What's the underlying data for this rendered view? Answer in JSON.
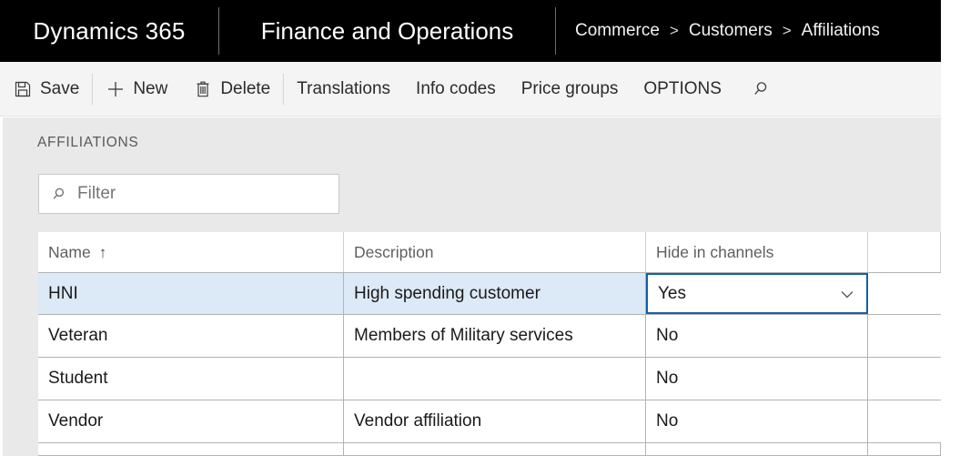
{
  "navbar": {
    "brand": "Dynamics 365",
    "app": "Finance and Operations",
    "breadcrumb": [
      "Commerce",
      "Customers",
      "Affiliations"
    ],
    "separator": ">"
  },
  "toolbar": {
    "items": [
      {
        "label": "Save",
        "icon": "save-icon"
      },
      {
        "label": "New",
        "icon": "plus-icon"
      },
      {
        "label": "Delete",
        "icon": "trash-icon"
      },
      {
        "label": "Translations",
        "icon": ""
      },
      {
        "label": "Info codes",
        "icon": ""
      },
      {
        "label": "Price groups",
        "icon": ""
      },
      {
        "label": "OPTIONS",
        "icon": ""
      }
    ],
    "search_icon": "search-icon"
  },
  "page": {
    "section_title": "AFFILIATIONS"
  },
  "filter": {
    "icon": "search-icon",
    "placeholder": "Filter",
    "value": ""
  },
  "grid": {
    "columns": [
      {
        "key": "name",
        "label": "Name",
        "sorted": true,
        "sort_arrow": "↑"
      },
      {
        "key": "description",
        "label": "Description",
        "sorted": false,
        "sort_arrow": ""
      },
      {
        "key": "hide_in_channels",
        "label": "Hide in channels",
        "sorted": false,
        "sort_arrow": ""
      }
    ],
    "rows": [
      {
        "name": "HNI",
        "description": "High spending customer",
        "hide_in_channels": "Yes",
        "selected": true
      },
      {
        "name": "Veteran",
        "description": "Members of Military services",
        "hide_in_channels": "No",
        "selected": false
      },
      {
        "name": "Student",
        "description": "",
        "hide_in_channels": "No",
        "selected": false
      },
      {
        "name": "Vendor",
        "description": "Vendor affiliation",
        "hide_in_channels": "No",
        "selected": false
      }
    ],
    "focused_cell": {
      "row": 0,
      "column": "hide_in_channels",
      "control": "dropdown",
      "value": "Yes"
    }
  },
  "colors": {
    "navbar_bg": "#000000",
    "toolbar_bg": "#f4f4f4",
    "page_bg": "#e9e9e9",
    "grid_bg": "#ffffff",
    "row_selected_bg": "#dce9f7",
    "focus_border": "#1260a8",
    "grid_line": "#b3b3b3",
    "muted_text": "#5f5f5f"
  }
}
